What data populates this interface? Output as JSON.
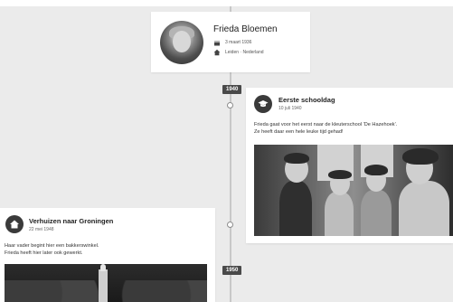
{
  "profile": {
    "name": "Frieda Bloemen",
    "birth_date": "3 maart 1936",
    "birth_place": "Leiden · Nederland"
  },
  "timeline": {
    "years": [
      "1940",
      "1950"
    ]
  },
  "events": [
    {
      "title": "Eerste schooldag",
      "date": "10 juli 1940",
      "text_line1": "Frieda gaat voor het eerst naar de kleuterschool 'De Hazehoek'.",
      "text_line2": "Ze heeft daar een hele leuke tijd gehad!",
      "icon": "graduation-cap-icon"
    },
    {
      "title": "Verhuizen naar Groningen",
      "date": "22 mei 1948",
      "text_line1": "Haar vader begint hier een bakkerswinkel.",
      "text_line2": "Frieda heeft hier later ook gewerkt.",
      "icon": "home-icon"
    }
  ],
  "colors": {
    "background": "#ebebeb",
    "card": "#ffffff",
    "year_tag": "#4a4a4a",
    "icon_circle": "#3a3a3a"
  }
}
